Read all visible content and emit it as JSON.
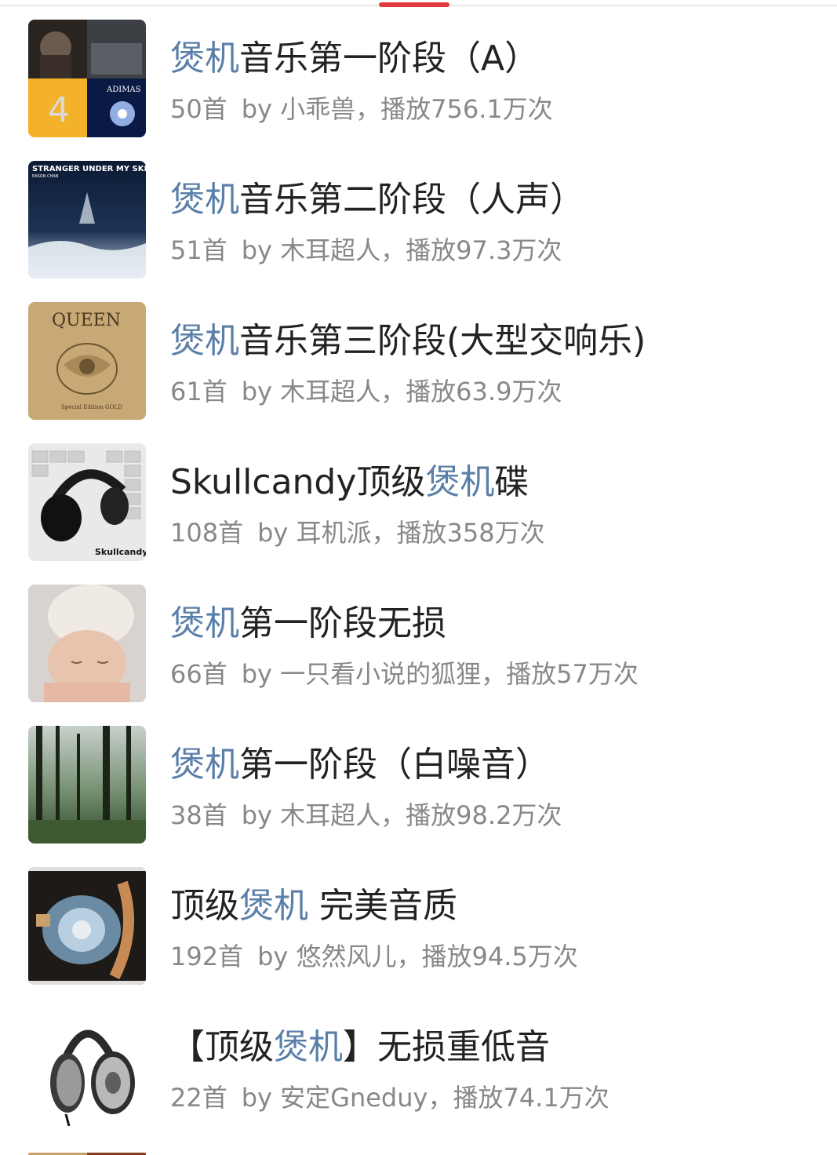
{
  "accent_color": "#e23a3a",
  "highlight_color": "#5a7fa8",
  "playlists": [
    {
      "title_pre": "",
      "title_hl": "煲机",
      "title_post": "音乐第一阶段（A）",
      "count": "50首",
      "by_label": "by",
      "author": "小乖兽",
      "plays": "，播放756.1万次",
      "cover_icon": "album-collage-cover"
    },
    {
      "title_pre": "",
      "title_hl": "煲机",
      "title_post": "音乐第二阶段（人声）",
      "count": "51首",
      "by_label": "by",
      "author": "木耳超人",
      "plays": "，播放97.3万次",
      "cover_icon": "stranger-under-my-skin-cover",
      "cover_text": "STRANGER UNDER MY SKIN",
      "cover_subtext": "EASON CHAN"
    },
    {
      "title_pre": "",
      "title_hl": "煲机",
      "title_post": "音乐第三阶段(大型交响乐)",
      "count": "61首",
      "by_label": "by",
      "author": "木耳超人",
      "plays": "，播放63.9万次",
      "cover_icon": "queen-crest-cover",
      "cover_text": "QUEEN",
      "cover_subtext": "Special Edition GOLD"
    },
    {
      "title_pre": "Skullcandy顶级",
      "title_hl": "煲机",
      "title_post": "碟",
      "count": "108首",
      "by_label": "by",
      "author": "耳机派",
      "plays": "，播放358万次",
      "cover_icon": "headphones-on-keyboard-cover",
      "cover_text": "Skullcandy"
    },
    {
      "title_pre": "",
      "title_hl": "煲机",
      "title_post": "第一阶段无损",
      "count": "66首",
      "by_label": "by",
      "author": "一只看小说的狐狸",
      "plays": "，播放57万次",
      "cover_icon": "sleeping-baby-cover"
    },
    {
      "title_pre": "",
      "title_hl": "煲机",
      "title_post": "第一阶段（白噪音）",
      "count": "38首",
      "by_label": "by",
      "author": "木耳超人",
      "plays": "，播放98.2万次",
      "cover_icon": "forest-cover"
    },
    {
      "title_pre": "顶级",
      "title_hl": "煲机",
      "title_post": " 完美音质",
      "count": "192首",
      "by_label": "by",
      "author": "悠然风儿",
      "plays": "，播放94.5万次",
      "cover_icon": "headphone-speaker-closeup-cover"
    },
    {
      "title_pre": "【顶级",
      "title_hl": "煲机",
      "title_post": "】无损重低音",
      "count": "22首",
      "by_label": "by",
      "author": "安定Gneduy",
      "plays": "，播放74.1万次",
      "cover_icon": "studio-headphones-cover"
    }
  ]
}
